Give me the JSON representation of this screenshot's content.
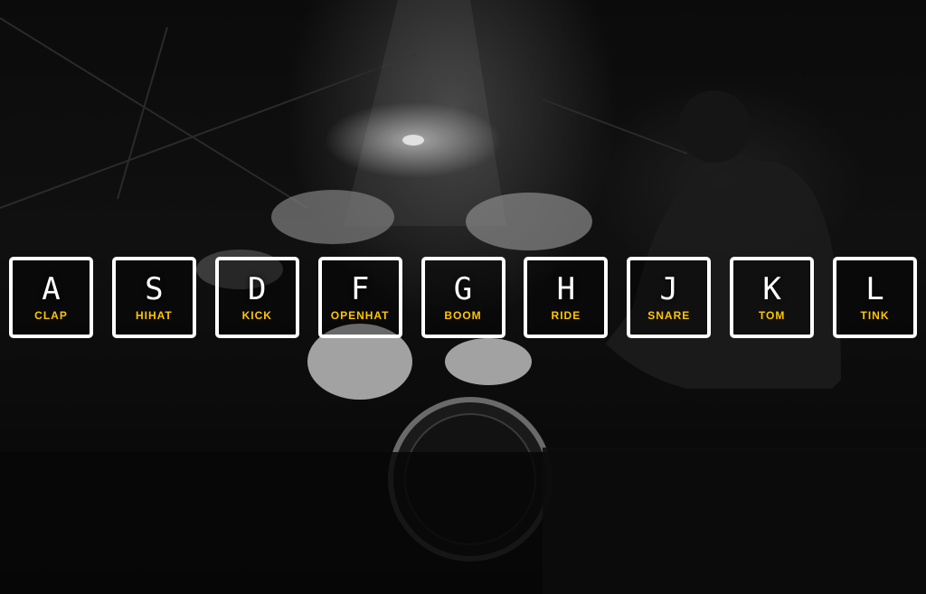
{
  "background": {
    "scene": "drummer-on-stage-photo",
    "accent_color": "#ffc600",
    "border_color": "#ffffff"
  },
  "keys": [
    {
      "letter": "A",
      "sound": "CLAP"
    },
    {
      "letter": "S",
      "sound": "HIHAT"
    },
    {
      "letter": "D",
      "sound": "KICK"
    },
    {
      "letter": "F",
      "sound": "OPENHAT"
    },
    {
      "letter": "G",
      "sound": "BOOM"
    },
    {
      "letter": "H",
      "sound": "RIDE"
    },
    {
      "letter": "J",
      "sound": "SNARE"
    },
    {
      "letter": "K",
      "sound": "TOM"
    },
    {
      "letter": "L",
      "sound": "TINK"
    }
  ]
}
